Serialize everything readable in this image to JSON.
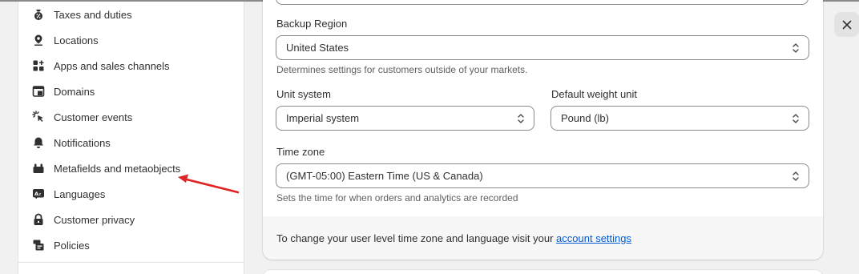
{
  "sidebar": {
    "items": [
      {
        "label": "Taxes and duties",
        "icon": "tax-icon"
      },
      {
        "label": "Locations",
        "icon": "location-pin-icon"
      },
      {
        "label": "Apps and sales channels",
        "icon": "apps-icon"
      },
      {
        "label": "Domains",
        "icon": "globe-window-icon"
      },
      {
        "label": "Customer events",
        "icon": "cursor-click-icon"
      },
      {
        "label": "Notifications",
        "icon": "bell-icon"
      },
      {
        "label": "Metafields and metaobjects",
        "icon": "metafields-icon"
      },
      {
        "label": "Languages",
        "icon": "language-icon"
      },
      {
        "label": "Customer privacy",
        "icon": "lock-icon"
      },
      {
        "label": "Policies",
        "icon": "policy-icon"
      }
    ]
  },
  "form": {
    "backup_region": {
      "label": "Backup Region",
      "value": "United States",
      "help": "Determines settings for customers outside of your markets."
    },
    "unit_system": {
      "label": "Unit system",
      "value": "Imperial system"
    },
    "weight_unit": {
      "label": "Default weight unit",
      "value": "Pound (lb)"
    },
    "time_zone": {
      "label": "Time zone",
      "value": "(GMT-05:00) Eastern Time (US & Canada)",
      "help": "Sets the time for when orders and analytics are recorded"
    },
    "footer": {
      "text": "To change your user level time zone and language visit your ",
      "link": "account settings"
    }
  },
  "colors": {
    "annotation_arrow": "#e02424",
    "link": "#005bd3"
  }
}
